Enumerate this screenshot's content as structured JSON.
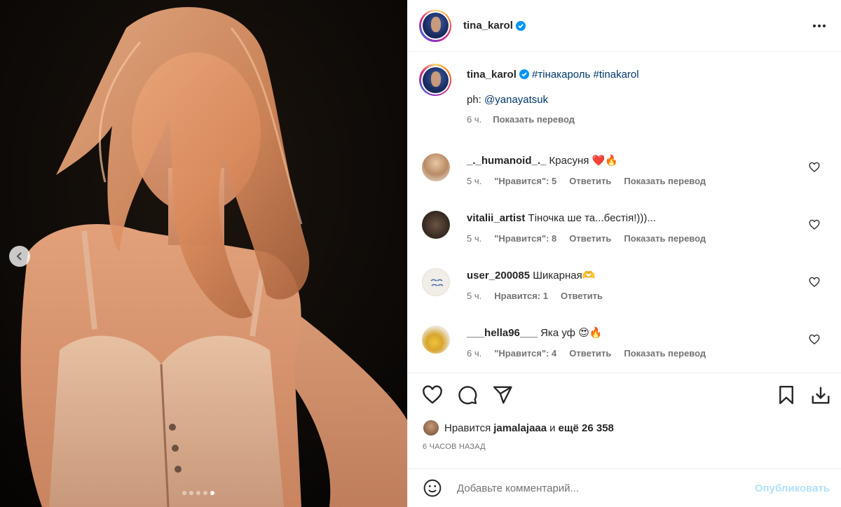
{
  "post": {
    "author": "tina_karol",
    "caption_tags": [
      "#тінакароль",
      "#tinakarol"
    ],
    "caption_credit_prefix": "ph:",
    "caption_credit_mention": "@yanayatsuk",
    "caption_time": "6 ч.",
    "translate_label": "Показать перевод"
  },
  "comments": [
    {
      "user": "_._humanoid_._",
      "text": "Красуня",
      "emoji": "❤️🔥",
      "time": "5 ч.",
      "likes": "\"Нравится\": 5",
      "reply": "Ответить",
      "translate": "Показать перевод"
    },
    {
      "user": "vitalii_artist",
      "text": "Тіночка ше та...бестія!)))...",
      "emoji": "",
      "time": "5 ч.",
      "likes": "\"Нравится\": 8",
      "reply": "Ответить",
      "translate": "Показать перевод"
    },
    {
      "user": "user_200085",
      "text": "Шикарная",
      "emoji": "🫶",
      "time": "5 ч.",
      "likes": "Нравится: 1",
      "reply": "Ответить",
      "translate": ""
    },
    {
      "user": "___hella96___",
      "text": "Яка уф",
      "emoji": "😍🔥",
      "time": "6 ч.",
      "likes": "\"Нравится\": 4",
      "reply": "Ответить",
      "translate": "Показать перевод"
    }
  ],
  "likes_summary": {
    "prefix": "Нравится",
    "user": "jamalajaaa",
    "connector": "и",
    "others": "ещё 26 358"
  },
  "time_ago": "6 ЧАСОВ НАЗАД",
  "comment_box": {
    "placeholder": "Добавьте комментарий...",
    "publish_label": "Опубликовать"
  },
  "carousel": {
    "count": 5,
    "active_index": 4
  },
  "colors": {
    "link": "#00376b",
    "verified": "#0095f6",
    "publish_disabled": "#b2dffc",
    "meta": "#737373"
  }
}
